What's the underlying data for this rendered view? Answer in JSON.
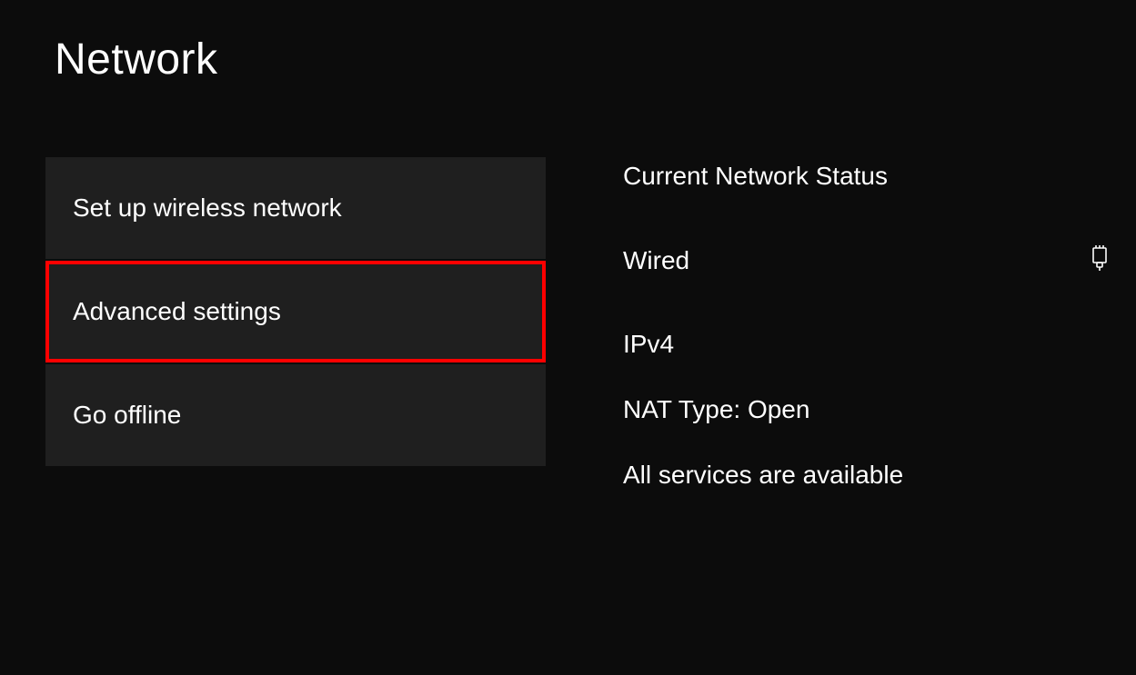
{
  "title": "Network",
  "menu": {
    "items": [
      {
        "label": "Set up wireless network",
        "highlighted": false
      },
      {
        "label": "Advanced settings",
        "highlighted": true
      },
      {
        "label": "Go offline",
        "highlighted": false
      }
    ]
  },
  "status": {
    "heading": "Current Network Status",
    "connection_type": "Wired",
    "icon": "ethernet-plug-icon",
    "ipv4": "IPv4",
    "nat_type": "NAT Type: Open",
    "services": "All services are available"
  }
}
